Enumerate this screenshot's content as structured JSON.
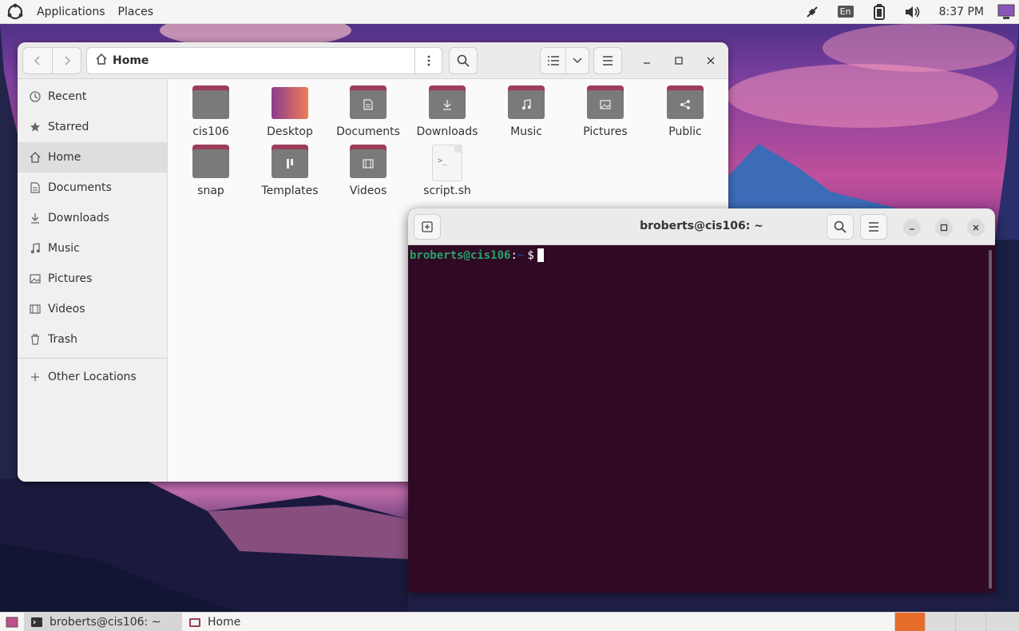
{
  "topbar": {
    "apps_label": "Applications",
    "places_label": "Places",
    "lang": "En",
    "clock": "8:37 PM"
  },
  "files": {
    "path": "Home",
    "sidebar": [
      {
        "label": "Recent",
        "icon": "clock-icon"
      },
      {
        "label": "Starred",
        "icon": "star-icon"
      },
      {
        "label": "Home",
        "icon": "home-icon"
      },
      {
        "label": "Documents",
        "icon": "document-icon"
      },
      {
        "label": "Downloads",
        "icon": "download-icon"
      },
      {
        "label": "Music",
        "icon": "music-icon"
      },
      {
        "label": "Pictures",
        "icon": "picture-icon"
      },
      {
        "label": "Videos",
        "icon": "video-icon"
      },
      {
        "label": "Trash",
        "icon": "trash-icon"
      }
    ],
    "other_locations": "Other Locations",
    "items": [
      {
        "label": "cis106",
        "kind": "folder"
      },
      {
        "label": "Desktop",
        "kind": "desktop"
      },
      {
        "label": "Documents",
        "kind": "folder"
      },
      {
        "label": "Downloads",
        "kind": "folder"
      },
      {
        "label": "Music",
        "kind": "folder"
      },
      {
        "label": "Pictures",
        "kind": "folder"
      },
      {
        "label": "Public",
        "kind": "folder"
      },
      {
        "label": "snap",
        "kind": "folder"
      },
      {
        "label": "Templates",
        "kind": "folder"
      },
      {
        "label": "Videos",
        "kind": "folder"
      },
      {
        "label": "script.sh",
        "kind": "file"
      }
    ]
  },
  "terminal": {
    "title": "broberts@cis106: ~",
    "prompt_user": "broberts@cis106",
    "prompt_sep": ":",
    "prompt_path": "~",
    "prompt_symbol": "$"
  },
  "taskbar": {
    "tasks": [
      {
        "label": "broberts@cis106: ~",
        "icon": "terminal-icon"
      },
      {
        "label": "Home",
        "icon": "files-icon"
      }
    ]
  },
  "colors": {
    "terminal_bg": "#300a24",
    "prompt_green": "#26a269",
    "folder_tab": "#9c3d5a"
  }
}
